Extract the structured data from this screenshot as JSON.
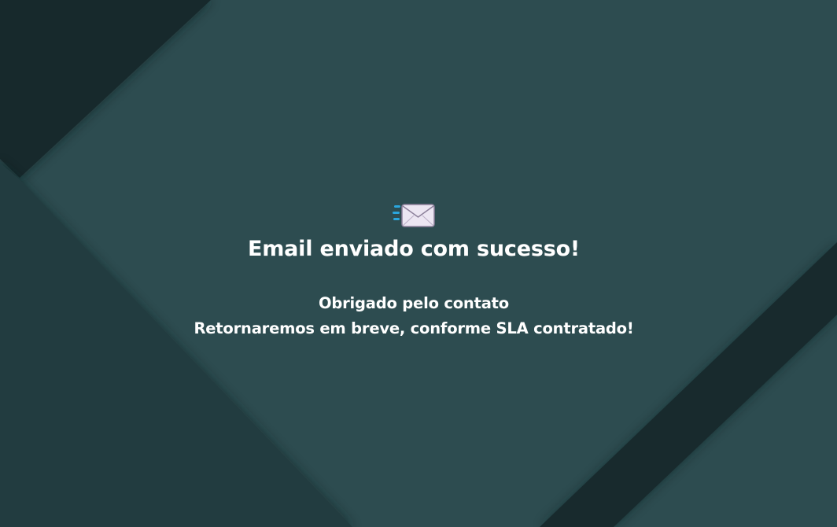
{
  "message": {
    "icon": "envelope-with-arrow-icon",
    "title": "Email enviado com sucesso!",
    "line1": "Obrigado pelo contato",
    "line2": "Retornaremos em breve, conforme SLA contratado!"
  },
  "colors": {
    "background": "#2d4c50",
    "panel_dark": "#1c3236",
    "panel_darker": "#15262a",
    "text": "#ffffff",
    "icon_accent": "#2aa6dd"
  }
}
